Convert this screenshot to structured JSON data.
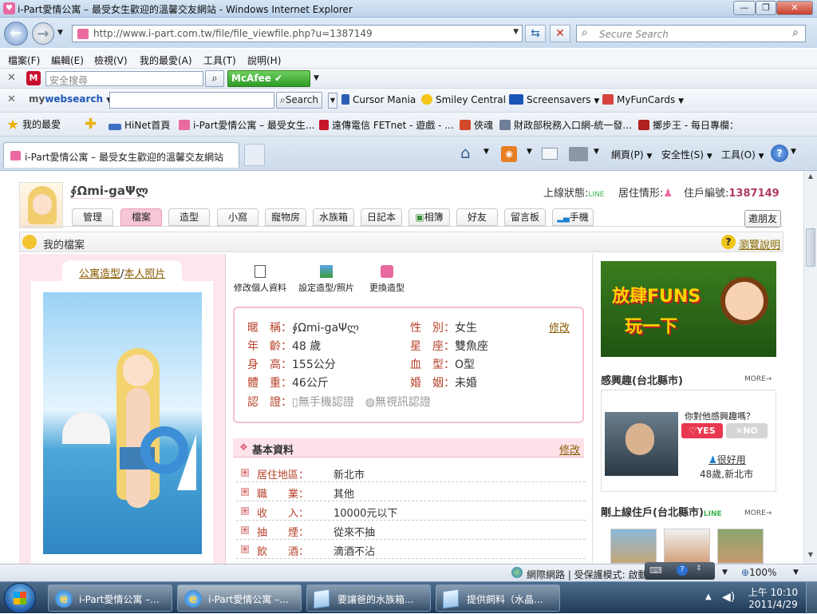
{
  "window": {
    "title": "i-Part愛情公寓 – 最受女生歡迎的溫馨交友網站 - Windows Internet Explorer"
  },
  "address": {
    "url": "http://www.i-part.com.tw/file/file_viewfile.php?u=1387149",
    "search_placeholder": "Secure Search"
  },
  "menubar": [
    "檔案(F)",
    "編輯(E)",
    "檢視(V)",
    "我的最愛(A)",
    "工具(T)",
    "說明(H)"
  ],
  "toolbar1": {
    "search_placeholder": "安全搜尋",
    "mcafee": "McAfee"
  },
  "toolbar2": {
    "brand_a": "my",
    "brand_b": "websearch",
    "search_btn": "Search",
    "links": [
      "Cursor Mania",
      "Smiley Central",
      "Screensavers",
      "MyFunCards"
    ]
  },
  "favorites": {
    "label": "我的最愛",
    "items": [
      "HiNet首頁",
      "i-Part愛情公寓 – 最受女生...",
      "遠傳電信 FETnet - 遊戲 - ...",
      "俠魂",
      "財政部稅務入口網-統一發...",
      "擲步王 - 每日專欄："
    ]
  },
  "tab": {
    "title": "i-Part愛情公寓 – 最受女生歡迎的溫馨交友網站"
  },
  "commandbar": {
    "page": "網頁(P)",
    "safety": "安全性(S)",
    "tools": "工具(O)"
  },
  "profile": {
    "nickname": "∮Ωmi-gaΨლ",
    "online_label": "上線狀態:",
    "online_badge": "LINE",
    "residence_label": "居住情形:",
    "member_label": "住戶編號:",
    "member_id": "1387149",
    "tabs": [
      "管理",
      "檔案",
      "造型",
      "小窩",
      "寵物房",
      "水族箱",
      "日記本",
      "相簿",
      "好友",
      "留言板",
      "手機"
    ],
    "invite": "邀朋友",
    "section_title": "我的檔案",
    "help": "瀏覽說明",
    "photo_links": {
      "a": "公寓造型",
      "sep": "/",
      "b": "本人照片"
    },
    "actions": [
      "修改個人資料",
      "設定造型/照片",
      "更換造型"
    ],
    "info": {
      "nickname_label": "暱　稱：",
      "nickname": "∮Ωmi-gaΨლ",
      "gender_label": "性　別：",
      "gender": "女生",
      "age_label": "年　齡：",
      "age": "48 歲",
      "sign_label": "星　座：",
      "sign": "雙魚座",
      "height_label": "身　高：",
      "height": "155公分",
      "blood_label": "血　型：",
      "blood": "O型",
      "weight_label": "體　重：",
      "weight": "46公斤",
      "marital_label": "婚　姻：",
      "marital": "未婚",
      "cert_label": "認　證：",
      "cert_phone": "無手機認證",
      "cert_video": "無視訊認證",
      "edit": "修改"
    },
    "basic": {
      "title": "基本資料",
      "edit": "修改",
      "rows": [
        {
          "label": "居住地區：",
          "value": "新北市"
        },
        {
          "label": "職　　業：",
          "value": "其他"
        },
        {
          "label": "收　　入：",
          "value": "10000元以下"
        },
        {
          "label": "抽　　煙：",
          "value": "從來不抽"
        },
        {
          "label": "飲　　酒：",
          "value": "滴酒不沾"
        }
      ]
    }
  },
  "sidebar": {
    "banner": {
      "line1": "放肆FUNS",
      "line2": "玩一下"
    },
    "interest": {
      "title": "感興趣(台北縣市)",
      "more": "MORE",
      "question": "你對他感興趣嗎？",
      "yes": "YES",
      "no": "NO",
      "name": "很好用",
      "info": "48歲,新北市"
    },
    "online": {
      "title": "剛上線住戶(台北縣市)",
      "badge": "LINE",
      "more": "MORE"
    }
  },
  "statusbar": {
    "zone": "網際網路 | 受保護模式: 啟動",
    "zoom": "100%"
  },
  "taskbar": {
    "apps": [
      "i-Part愛情公寓 –...",
      "i-Part愛情公寓 –...",
      "要讓爸的水族箱...",
      "提供飼料（水晶..."
    ],
    "time": "上午 10:10",
    "date": "2011/4/29"
  },
  "colors": {
    "accent_pink": "#e86aa0",
    "label_red": "#b7412a",
    "member_id": "#b03a5b"
  }
}
